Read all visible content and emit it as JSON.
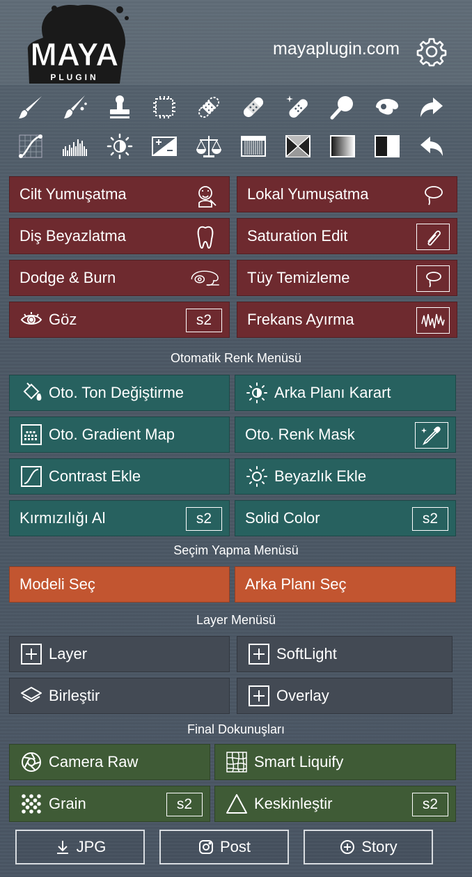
{
  "header": {
    "logo_text": "MAYA",
    "logo_sub": "PLUGIN",
    "site": "mayaplugin.com"
  },
  "tools": {
    "row1": [
      "brush-icon",
      "brush-mixer-icon",
      "stamp-icon",
      "marquee-icon",
      "bandage-dotted-icon",
      "bandage-icon",
      "bandage-sparkle-icon",
      "magnifier-icon",
      "lasso-hand-icon",
      "redo-arrow-icon"
    ],
    "row2": [
      "curves-icon",
      "histogram-icon",
      "brightness-icon",
      "exposure-icon",
      "balance-icon",
      "gradient-bars-icon",
      "envelope-mask-icon",
      "gradient-icon",
      "half-square-icon",
      "undo-arrow-icon"
    ]
  },
  "retouch": {
    "cilt": "Cilt Yumuşatma",
    "lokal": "Lokal Yumuşatma",
    "dis": "Diş Beyazlatma",
    "saturation": "Saturation Edit",
    "dodge": "Dodge & Burn",
    "tuy": "Tüy Temizleme",
    "goz": "Göz",
    "goz_badge": "s2",
    "frekans": "Frekans Ayırma"
  },
  "auto_color": {
    "title": "Otomatik Renk Menüsü",
    "ton": "Oto. Ton Değiştirme",
    "arka_karart": "Arka Planı Karart",
    "gradient": "Oto. Gradient Map",
    "renk_mask": "Oto. Renk Mask",
    "contrast": "Contrast Ekle",
    "beyazlik": "Beyazlık Ekle",
    "kirmizi": "Kırmızılığı Al",
    "kirmizi_badge": "s2",
    "solid": "Solid Color",
    "solid_badge": "s2"
  },
  "selection": {
    "title": "Seçim Yapma Menüsü",
    "model": "Modeli Seç",
    "arka": "Arka Planı Seç"
  },
  "layer": {
    "title": "Layer Menüsü",
    "layer": "Layer",
    "softlight": "SoftLight",
    "birlestir": "Birleştir",
    "overlay": "Overlay"
  },
  "final": {
    "title": "Final Dokunuşları",
    "camera": "Camera Raw",
    "liquify": "Smart Liquify",
    "grain": "Grain",
    "grain_badge": "s2",
    "keskin": "Keskinleştir",
    "keskin_badge": "s2"
  },
  "export": {
    "jpg": "JPG",
    "post": "Post",
    "story": "Story"
  },
  "colors": {
    "retouch": "#6e2a2f",
    "auto_color": "#27615f",
    "selection": "#c25530",
    "layer": "#434a54",
    "final": "#3f5b36"
  }
}
